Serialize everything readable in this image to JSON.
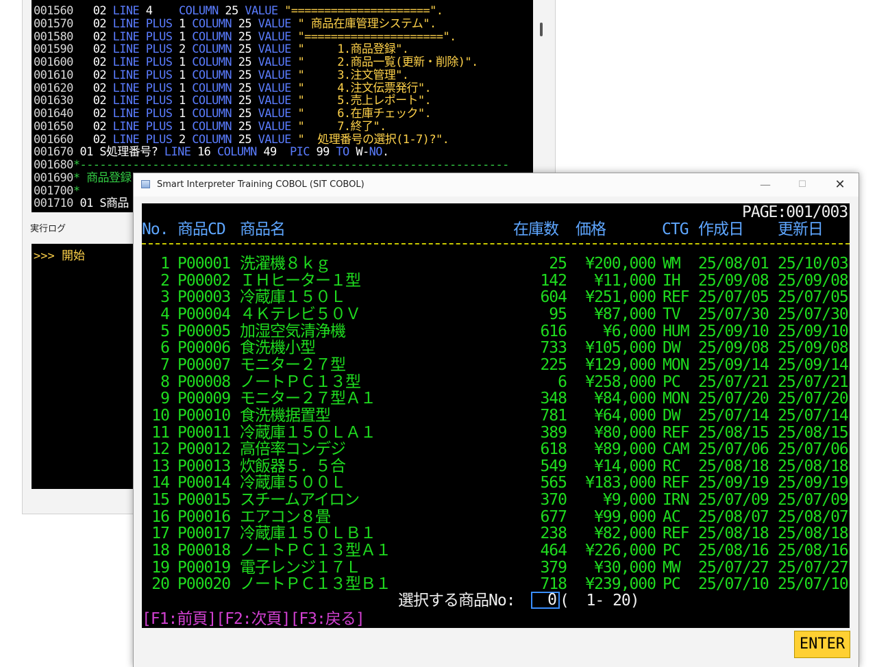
{
  "editor": {
    "lines": [
      {
        "num": "001560",
        "parts": [
          [
            "cw",
            "   02 "
          ],
          [
            "ck",
            "LINE"
          ],
          [
            "cw",
            " 4    "
          ],
          [
            "ck",
            "COLUMN"
          ],
          [
            "cw",
            " 25 "
          ],
          [
            "ck",
            "VALUE"
          ],
          [
            "cw",
            " "
          ],
          [
            "cs",
            "\"=====================\"."
          ]
        ]
      },
      {
        "num": "001570",
        "parts": [
          [
            "cw",
            "   02 "
          ],
          [
            "ck",
            "LINE PLUS"
          ],
          [
            "cw",
            " 1 "
          ],
          [
            "ck",
            "COLUMN"
          ],
          [
            "cw",
            " 25 "
          ],
          [
            "ck",
            "VALUE"
          ],
          [
            "cw",
            " "
          ],
          [
            "cs",
            "\" 商品在庫管理システム\"."
          ]
        ]
      },
      {
        "num": "001580",
        "parts": [
          [
            "cw",
            "   02 "
          ],
          [
            "ck",
            "LINE PLUS"
          ],
          [
            "cw",
            " 1 "
          ],
          [
            "ck",
            "COLUMN"
          ],
          [
            "cw",
            " 25 "
          ],
          [
            "ck",
            "VALUE"
          ],
          [
            "cw",
            " "
          ],
          [
            "cs",
            "\"=====================\"."
          ]
        ]
      },
      {
        "num": "001590",
        "parts": [
          [
            "cw",
            "   02 "
          ],
          [
            "ck",
            "LINE PLUS"
          ],
          [
            "cw",
            " 2 "
          ],
          [
            "ck",
            "COLUMN"
          ],
          [
            "cw",
            " 25 "
          ],
          [
            "ck",
            "VALUE"
          ],
          [
            "cw",
            " "
          ],
          [
            "cs",
            "\"     1.商品登録\"."
          ]
        ]
      },
      {
        "num": "001600",
        "parts": [
          [
            "cw",
            "   02 "
          ],
          [
            "ck",
            "LINE PLUS"
          ],
          [
            "cw",
            " 1 "
          ],
          [
            "ck",
            "COLUMN"
          ],
          [
            "cw",
            " 25 "
          ],
          [
            "ck",
            "VALUE"
          ],
          [
            "cw",
            " "
          ],
          [
            "cs",
            "\"     2.商品一覧(更新・削除)\"."
          ]
        ]
      },
      {
        "num": "001610",
        "parts": [
          [
            "cw",
            "   02 "
          ],
          [
            "ck",
            "LINE PLUS"
          ],
          [
            "cw",
            " 1 "
          ],
          [
            "ck",
            "COLUMN"
          ],
          [
            "cw",
            " 25 "
          ],
          [
            "ck",
            "VALUE"
          ],
          [
            "cw",
            " "
          ],
          [
            "cs",
            "\"     3.注文管理\"."
          ]
        ]
      },
      {
        "num": "001620",
        "parts": [
          [
            "cw",
            "   02 "
          ],
          [
            "ck",
            "LINE PLUS"
          ],
          [
            "cw",
            " 1 "
          ],
          [
            "ck",
            "COLUMN"
          ],
          [
            "cw",
            " 25 "
          ],
          [
            "ck",
            "VALUE"
          ],
          [
            "cw",
            " "
          ],
          [
            "cs",
            "\"     4.注文伝票発行\"."
          ]
        ]
      },
      {
        "num": "001630",
        "parts": [
          [
            "cw",
            "   02 "
          ],
          [
            "ck",
            "LINE PLUS"
          ],
          [
            "cw",
            " 1 "
          ],
          [
            "ck",
            "COLUMN"
          ],
          [
            "cw",
            " 25 "
          ],
          [
            "ck",
            "VALUE"
          ],
          [
            "cw",
            " "
          ],
          [
            "cs",
            "\"     5.売上レポート\"."
          ]
        ]
      },
      {
        "num": "001640",
        "parts": [
          [
            "cw",
            "   02 "
          ],
          [
            "ck",
            "LINE PLUS"
          ],
          [
            "cw",
            " 1 "
          ],
          [
            "ck",
            "COLUMN"
          ],
          [
            "cw",
            " 25 "
          ],
          [
            "ck",
            "VALUE"
          ],
          [
            "cw",
            " "
          ],
          [
            "cs",
            "\"     6.在庫チェック\"."
          ]
        ]
      },
      {
        "num": "001650",
        "parts": [
          [
            "cw",
            "   02 "
          ],
          [
            "ck",
            "LINE PLUS"
          ],
          [
            "cw",
            " 1 "
          ],
          [
            "ck",
            "COLUMN"
          ],
          [
            "cw",
            " 25 "
          ],
          [
            "ck",
            "VALUE"
          ],
          [
            "cw",
            " "
          ],
          [
            "cs",
            "\"     7.終了\"."
          ]
        ]
      },
      {
        "num": "001660",
        "parts": [
          [
            "cw",
            "   02 "
          ],
          [
            "ck",
            "LINE PLUS"
          ],
          [
            "cw",
            " 2 "
          ],
          [
            "ck",
            "COLUMN"
          ],
          [
            "cw",
            " 25 "
          ],
          [
            "ck",
            "VALUE"
          ],
          [
            "cw",
            " "
          ],
          [
            "cs",
            "\"  処理番号の選択(1-7)?\"."
          ]
        ]
      },
      {
        "num": "001670",
        "parts": [
          [
            "cw",
            " 01 S処理番号? "
          ],
          [
            "ck",
            "LINE"
          ],
          [
            "cw",
            " 16 "
          ],
          [
            "ck",
            "COLUMN"
          ],
          [
            "cw",
            " 49  "
          ],
          [
            "ck",
            "PIC"
          ],
          [
            "cw",
            " 99 "
          ],
          [
            "ck",
            "TO"
          ],
          [
            "cw",
            " W-"
          ],
          [
            "ck",
            "NO"
          ],
          [
            "cw",
            "."
          ]
        ]
      },
      {
        "num": "001680",
        "parts": [
          [
            "cc",
            "*-----------------------------------------------------------------"
          ]
        ]
      },
      {
        "num": "001690",
        "parts": [
          [
            "cc",
            "* 商品登録"
          ]
        ]
      },
      {
        "num": "001700",
        "parts": [
          [
            "cc",
            "*"
          ]
        ]
      },
      {
        "num": "001710",
        "parts": [
          [
            "cw",
            " 01 S商品"
          ]
        ]
      }
    ]
  },
  "log": {
    "label": "実行ログ",
    "text": ">>> 開始"
  },
  "window": {
    "title": "Smart Interpreter Training COBOL (SIT COBOL)",
    "min": "—",
    "max": "☐",
    "close": "✕"
  },
  "screen": {
    "page": "PAGE:001/003",
    "headers": {
      "no": "No.",
      "cd": "商品CD",
      "name": "商品名",
      "stock": "在庫数",
      "price": "価格",
      "ctg": "CTG",
      "created": "作成日",
      "updated": "更新日"
    },
    "rows": [
      {
        "no": "1",
        "cd": "P00001",
        "name": "洗濯機８ｋｇ",
        "stock": "25",
        "price": "¥200,000",
        "ctg": "WM",
        "created": "25/08/01",
        "updated": "25/10/03"
      },
      {
        "no": "2",
        "cd": "P00002",
        "name": "ＩＨヒーター１型",
        "stock": "142",
        "price": "¥11,000",
        "ctg": "IH",
        "created": "25/09/08",
        "updated": "25/09/08"
      },
      {
        "no": "3",
        "cd": "P00003",
        "name": "冷蔵庫１５０Ｌ",
        "stock": "604",
        "price": "¥251,000",
        "ctg": "REF",
        "created": "25/07/05",
        "updated": "25/07/05"
      },
      {
        "no": "4",
        "cd": "P00004",
        "name": "４Ｋテレビ５０Ｖ",
        "stock": "95",
        "price": "¥87,000",
        "ctg": "TV",
        "created": "25/07/30",
        "updated": "25/07/30"
      },
      {
        "no": "5",
        "cd": "P00005",
        "name": "加湿空気清浄機",
        "stock": "616",
        "price": "¥6,000",
        "ctg": "HUM",
        "created": "25/09/10",
        "updated": "25/09/10"
      },
      {
        "no": "6",
        "cd": "P00006",
        "name": "食洗機小型",
        "stock": "733",
        "price": "¥105,000",
        "ctg": "DW",
        "created": "25/09/08",
        "updated": "25/09/08"
      },
      {
        "no": "7",
        "cd": "P00007",
        "name": "モニター２７型",
        "stock": "225",
        "price": "¥129,000",
        "ctg": "MON",
        "created": "25/09/14",
        "updated": "25/09/14"
      },
      {
        "no": "8",
        "cd": "P00008",
        "name": "ノートＰＣ１３型",
        "stock": "6",
        "price": "¥258,000",
        "ctg": "PC",
        "created": "25/07/21",
        "updated": "25/07/21"
      },
      {
        "no": "9",
        "cd": "P00009",
        "name": "モニター２７型Ａ１",
        "stock": "348",
        "price": "¥84,000",
        "ctg": "MON",
        "created": "25/07/20",
        "updated": "25/07/20"
      },
      {
        "no": "10",
        "cd": "P00010",
        "name": "食洗機据置型",
        "stock": "781",
        "price": "¥64,000",
        "ctg": "DW",
        "created": "25/07/14",
        "updated": "25/07/14"
      },
      {
        "no": "11",
        "cd": "P00011",
        "name": "冷蔵庫１５０ＬＡ１",
        "stock": "389",
        "price": "¥80,000",
        "ctg": "REF",
        "created": "25/08/15",
        "updated": "25/08/15"
      },
      {
        "no": "12",
        "cd": "P00012",
        "name": "高倍率コンデジ",
        "stock": "618",
        "price": "¥89,000",
        "ctg": "CAM",
        "created": "25/07/06",
        "updated": "25/07/06"
      },
      {
        "no": "13",
        "cd": "P00013",
        "name": "炊飯器５．５合",
        "stock": "549",
        "price": "¥14,000",
        "ctg": "RC",
        "created": "25/08/18",
        "updated": "25/08/18"
      },
      {
        "no": "14",
        "cd": "P00014",
        "name": "冷蔵庫５００Ｌ",
        "stock": "565",
        "price": "¥183,000",
        "ctg": "REF",
        "created": "25/09/19",
        "updated": "25/09/19"
      },
      {
        "no": "15",
        "cd": "P00015",
        "name": "スチームアイロン",
        "stock": "370",
        "price": "¥9,000",
        "ctg": "IRN",
        "created": "25/07/09",
        "updated": "25/07/09"
      },
      {
        "no": "16",
        "cd": "P00016",
        "name": "エアコン８畳",
        "stock": "677",
        "price": "¥99,000",
        "ctg": "AC",
        "created": "25/08/07",
        "updated": "25/08/07"
      },
      {
        "no": "17",
        "cd": "P00017",
        "name": "冷蔵庫１５０ＬＢ１",
        "stock": "238",
        "price": "¥82,000",
        "ctg": "REF",
        "created": "25/08/18",
        "updated": "25/08/18"
      },
      {
        "no": "18",
        "cd": "P00018",
        "name": "ノートＰＣ１３型Ａ１",
        "stock": "464",
        "price": "¥226,000",
        "ctg": "PC",
        "created": "25/08/16",
        "updated": "25/08/16"
      },
      {
        "no": "19",
        "cd": "P00019",
        "name": "電子レンジ１７Ｌ",
        "stock": "379",
        "price": "¥30,000",
        "ctg": "MW",
        "created": "25/07/27",
        "updated": "25/07/27"
      },
      {
        "no": "20",
        "cd": "P00020",
        "name": "ノートＰＣ１３型Ｂ１",
        "stock": "718",
        "price": "¥239,000",
        "ctg": "PC",
        "created": "25/07/10",
        "updated": "25/07/10"
      }
    ],
    "prompt_label": "選択する商品No:",
    "prompt_value": "0",
    "prompt_range": "(  1- 20)",
    "fkeys": "[F1:前頁][F2:次頁][F3:戻る]"
  },
  "enter_label": "ENTER"
}
